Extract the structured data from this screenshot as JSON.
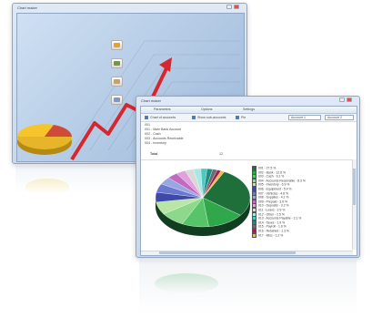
{
  "window_back": {
    "title": "Chart maker"
  },
  "window_front": {
    "title": "Chart maker",
    "tabs": [
      "Parameters",
      "Options",
      "Settings"
    ],
    "toolbar": {
      "option1": "Chart of accounts",
      "option2": "Show sub-accounts",
      "option3": "Pie",
      "select1": "Account 1",
      "select2": "Account 2"
    },
    "accounts": [
      "001",
      "001 - Main Bank Account",
      "002 - Cash",
      "003 - Accounts Receivable",
      "004 - Inventory"
    ],
    "total_label": "Total",
    "total_value": "12"
  },
  "legend": [
    {
      "label": "001 - 27.5 %",
      "color": "#1e6f3a"
    },
    {
      "label": "002 - Bank - 12.6 %",
      "color": "#2ea84a"
    },
    {
      "label": "003 - Cash - 9.1 %",
      "color": "#57c46a"
    },
    {
      "label": "004 - Accounts Receivable - 8.3 %",
      "color": "#8dd88a"
    },
    {
      "label": "005 - Inventory - 6.9 %",
      "color": "#b8e6a6"
    },
    {
      "label": "006 - Equipment - 5.4 %",
      "color": "#3f49a8"
    },
    {
      "label": "007 - Vehicles - 4.8 %",
      "color": "#6a78cf"
    },
    {
      "label": "008 - Supplies - 4.1 %",
      "color": "#9aa6e2"
    },
    {
      "label": "009 - Prepaid - 3.6 %",
      "color": "#c26ac0"
    },
    {
      "label": "010 - Deposits - 3.2 %",
      "color": "#e0a1de"
    },
    {
      "label": "011 - Loans - 2.9 %",
      "color": "#d9d9d9"
    },
    {
      "label": "012 - Other - 2.5 %",
      "color": "#a7e8e4"
    },
    {
      "label": "013 - Accounts Payable - 2.1 %",
      "color": "#4dc7c0"
    },
    {
      "label": "014 - Taxes - 1.9 %",
      "color": "#1c8f87"
    },
    {
      "label": "015 - Payroll - 1.6 %",
      "color": "#6c6c6c"
    },
    {
      "label": "016 - Retained - 1.3 %",
      "color": "#9b1f4f"
    },
    {
      "label": "017 - Misc - 1.2 %",
      "color": "#f2b94a"
    }
  ],
  "chart_data": {
    "type": "pie",
    "title": "",
    "slices": [
      {
        "label": "001",
        "value": 27.5,
        "color": "#1e6f3a"
      },
      {
        "label": "002",
        "value": 12.6,
        "color": "#2ea84a"
      },
      {
        "label": "003",
        "value": 9.1,
        "color": "#57c46a"
      },
      {
        "label": "004",
        "value": 8.3,
        "color": "#8dd88a"
      },
      {
        "label": "005",
        "value": 6.9,
        "color": "#b8e6a6"
      },
      {
        "label": "006",
        "value": 5.4,
        "color": "#3f49a8"
      },
      {
        "label": "007",
        "value": 4.8,
        "color": "#6a78cf"
      },
      {
        "label": "008",
        "value": 4.1,
        "color": "#9aa6e2"
      },
      {
        "label": "009",
        "value": 3.6,
        "color": "#c26ac0"
      },
      {
        "label": "010",
        "value": 3.2,
        "color": "#e0a1de"
      },
      {
        "label": "011",
        "value": 2.9,
        "color": "#d9d9d9"
      },
      {
        "label": "012",
        "value": 2.5,
        "color": "#a7e8e4"
      },
      {
        "label": "013",
        "value": 2.1,
        "color": "#4dc7c0"
      },
      {
        "label": "014",
        "value": 1.9,
        "color": "#1c8f87"
      },
      {
        "label": "015",
        "value": 1.6,
        "color": "#6c6c6c"
      },
      {
        "label": "016",
        "value": 1.3,
        "color": "#9b1f4f"
      },
      {
        "label": "017",
        "value": 1.2,
        "color": "#f2b94a"
      }
    ]
  }
}
